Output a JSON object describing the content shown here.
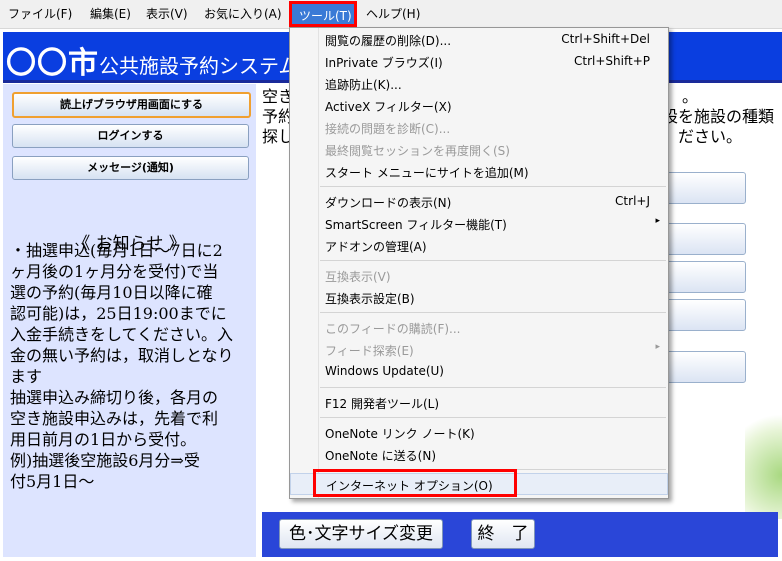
{
  "menubar": {
    "items": [
      {
        "label": "ファイル(F)"
      },
      {
        "label": "編集(E)"
      },
      {
        "label": "表示(V)"
      },
      {
        "label": "お気に入り(A)"
      },
      {
        "label": "ツール(T)"
      },
      {
        "label": "ヘルプ(H)"
      }
    ]
  },
  "banner": {
    "city": "〇〇市",
    "title": "公共施設予約システム"
  },
  "sidebar": {
    "buttons": [
      {
        "label": "読上げブラウザ用画面にする"
      },
      {
        "label": "ログインする"
      },
      {
        "label": "メッセージ(通知)"
      }
    ],
    "notice_title": "《 お知らせ 》",
    "notice_lines": [
      "・抽選申込(毎月1日〜7日に2",
      "ヶ月後の1ヶ月分を受付)で当",
      "選の予約(毎月10日以降に確",
      "認可能)は，25日19:00までに",
      "入金手続きをしてください。入",
      "金の無い予約は，取消しとなり",
      "ます",
      "抽選申込み締切り後，各月の",
      "空き施設申込みは，先着で利",
      "用日前月の1日から受付。",
      "例)抽選後空施設6月分⇒受",
      "付5月1日〜"
    ]
  },
  "main": {
    "left_lines": [
      "空き",
      "予約",
      "探し"
    ],
    "right_lines": [
      "。",
      "設を施設の種類",
      "ださい。"
    ]
  },
  "bottom": {
    "color_button": "色･文字サイズ変更",
    "exit_button": "終　了"
  },
  "tools_menu": {
    "items": [
      {
        "label": "閲覧の履歴の削除(D)...",
        "shortcut": "Ctrl+Shift+Del",
        "disabled": false
      },
      {
        "label": "InPrivate ブラウズ(I)",
        "shortcut": "Ctrl+Shift+P",
        "disabled": false
      },
      {
        "label": "追跡防止(K)...",
        "shortcut": "",
        "disabled": false
      },
      {
        "label": "ActiveX フィルター(X)",
        "shortcut": "",
        "disabled": false
      },
      {
        "label": "接続の問題を診断(C)...",
        "shortcut": "",
        "disabled": true
      },
      {
        "label": "最終閲覧セッションを再度開く(S)",
        "shortcut": "",
        "disabled": true
      },
      {
        "label": "スタート メニューにサイトを追加(M)",
        "shortcut": "",
        "disabled": false
      },
      {
        "label": "ダウンロードの表示(N)",
        "shortcut": "Ctrl+J",
        "disabled": false
      },
      {
        "label": "SmartScreen フィルター機能(T)",
        "shortcut": "",
        "disabled": false
      },
      {
        "label": "アドオンの管理(A)",
        "shortcut": "",
        "disabled": false
      },
      {
        "label": "互換表示(V)",
        "shortcut": "",
        "disabled": true
      },
      {
        "label": "互換表示設定(B)",
        "shortcut": "",
        "disabled": false
      },
      {
        "label": "このフィードの購読(F)...",
        "shortcut": "",
        "disabled": true
      },
      {
        "label": "フィード探索(E)",
        "shortcut": "",
        "disabled": true
      },
      {
        "label": "Windows Update(U)",
        "shortcut": "",
        "disabled": false
      },
      {
        "label": "F12 開発者ツール(L)",
        "shortcut": "",
        "disabled": false
      },
      {
        "label": "OneNote リンク ノート(K)",
        "shortcut": "",
        "disabled": false
      },
      {
        "label": "OneNote に送る(N)",
        "shortcut": "",
        "disabled": false
      },
      {
        "label": "インターネット オプション(O)",
        "shortcut": "",
        "disabled": false
      }
    ],
    "submenu_arrow": "▸"
  },
  "colors": {
    "highlight_red": "#ff0000",
    "banner_blue": "#0a3ee0",
    "sidebar_bg": "#dde4ff"
  }
}
